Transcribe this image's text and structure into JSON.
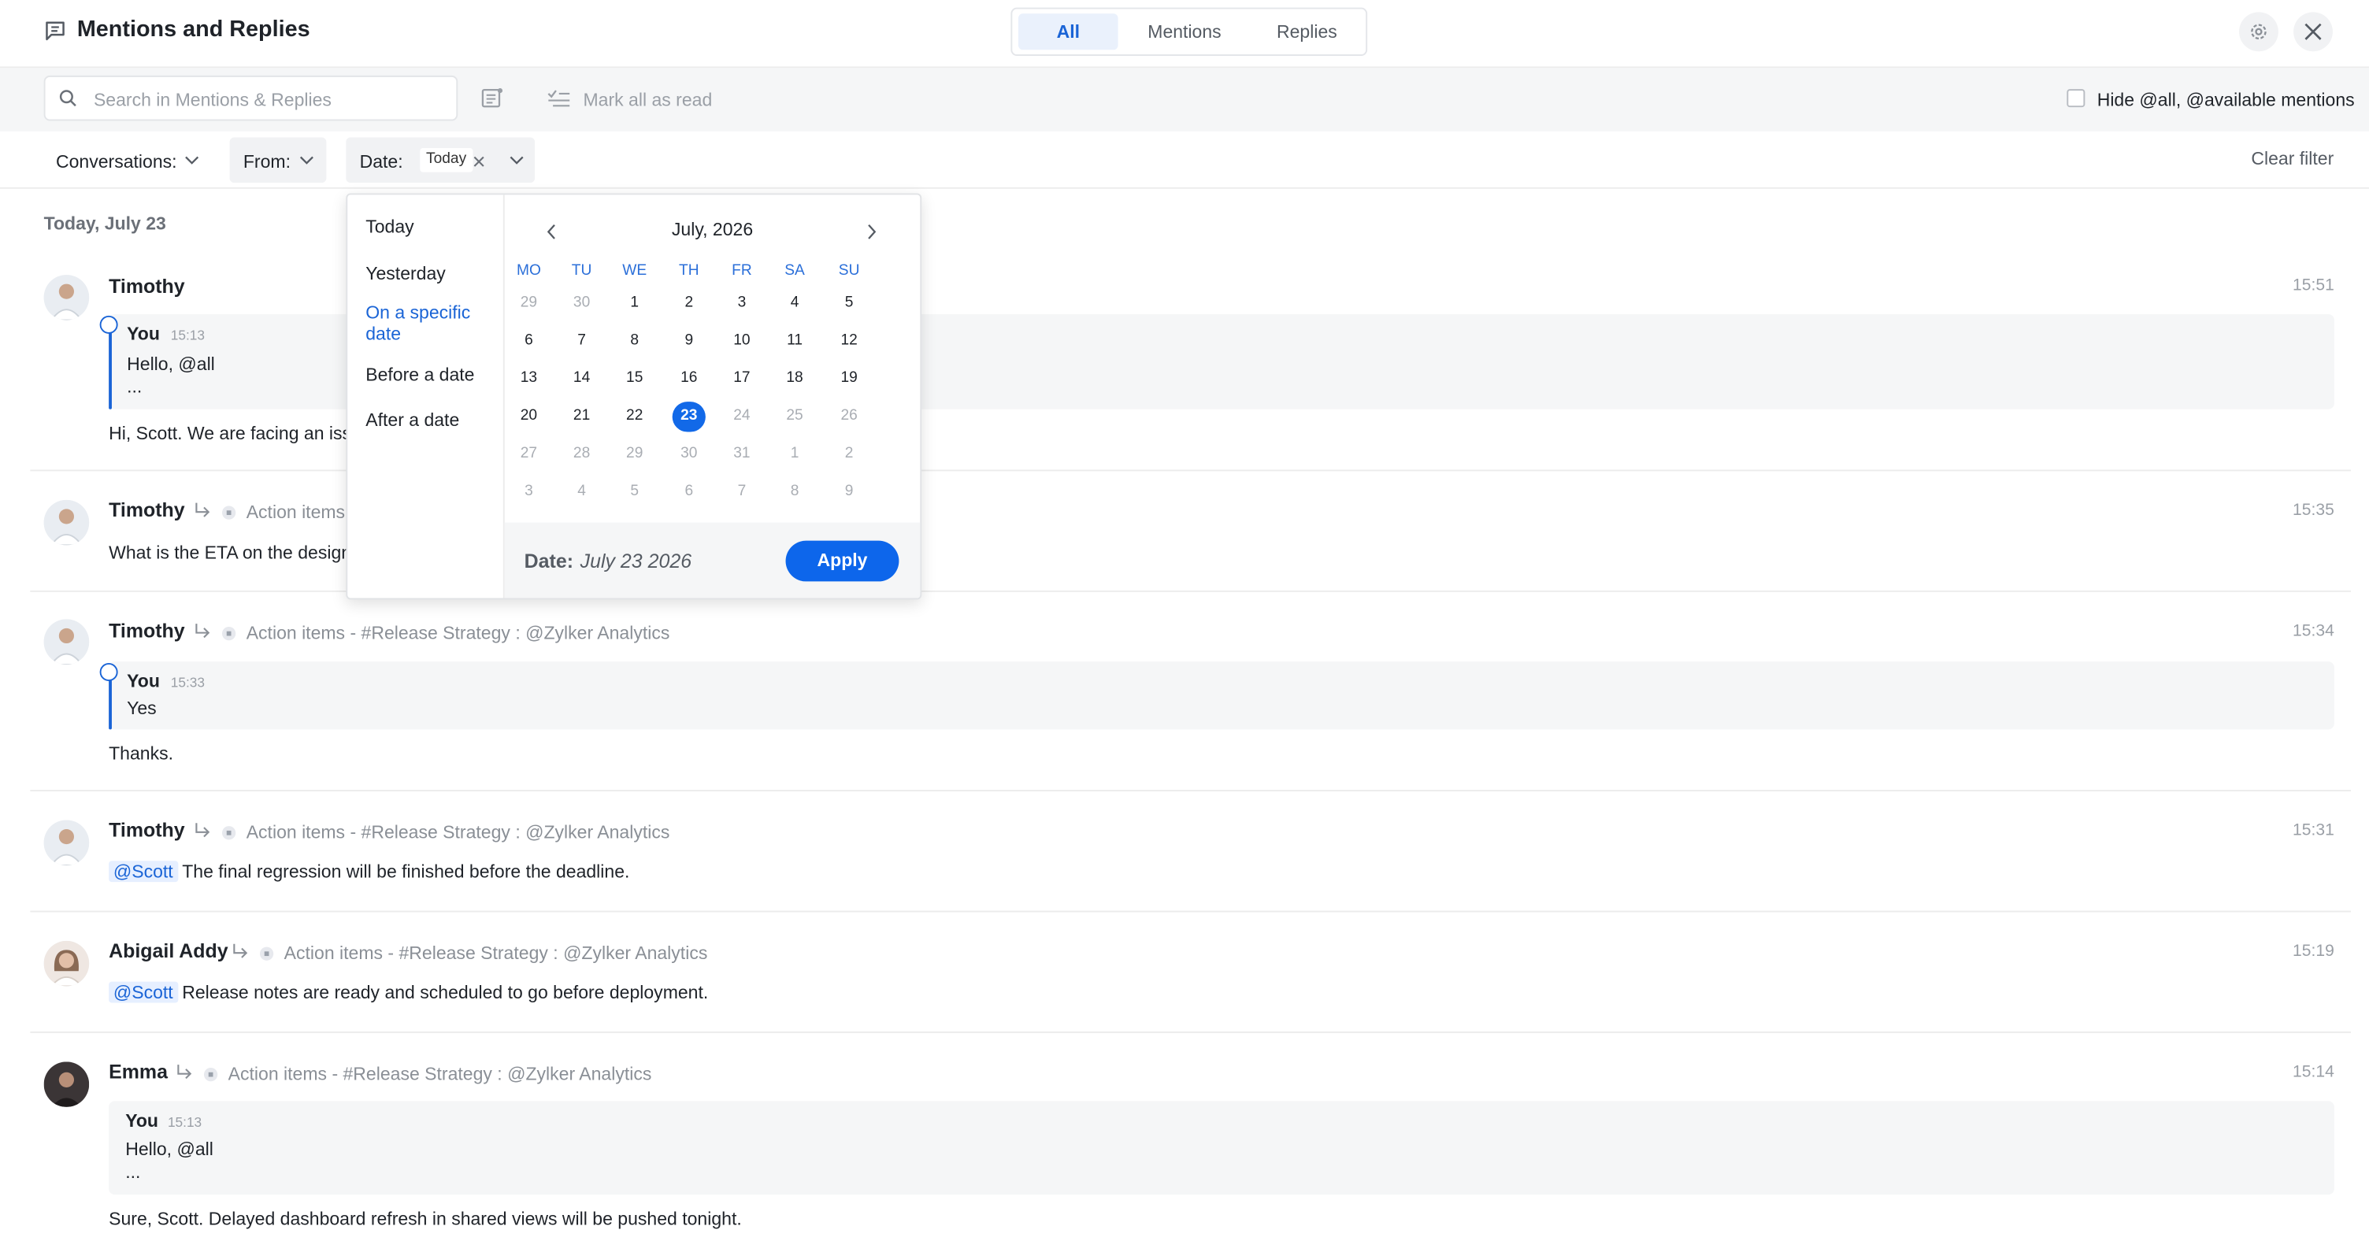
{
  "header": {
    "title": "Mentions and Replies",
    "tabs": [
      {
        "label": "All",
        "active": true
      },
      {
        "label": "Mentions",
        "active": false
      },
      {
        "label": "Replies",
        "active": false
      }
    ]
  },
  "toolbar": {
    "search_placeholder": "Search in Mentions & Replies",
    "mark_all_read": "Mark all as read",
    "hide_all_label": "Hide @all, @available mentions"
  },
  "filters": {
    "conversations": "Conversations:",
    "from": "From:",
    "date": "Date:",
    "date_chip": "Today",
    "clear": "Clear filter"
  },
  "date_heading": "Today, July 23",
  "messages": [
    {
      "name": "Timothy",
      "time": "15:51",
      "context": "",
      "quote": {
        "name": "You",
        "time": "15:13",
        "lines": [
          "Hello, @all",
          "..."
        ]
      },
      "mention": "",
      "text": "Hi, Scott. We are facing an issue"
    },
    {
      "name": "Timothy",
      "time": "15:35",
      "context": "Action items -",
      "mention": "",
      "text": "What is the ETA on the design?"
    },
    {
      "name": "Timothy",
      "time": "15:34",
      "context": "Action items - #Release Strategy : @Zylker Analytics",
      "quote": {
        "name": "You",
        "time": "15:33",
        "lines": [
          "Yes"
        ]
      },
      "mention": "",
      "text": "Thanks."
    },
    {
      "name": "Timothy",
      "time": "15:31",
      "context": "Action items - #Release Strategy : @Zylker Analytics",
      "mention": "@Scott",
      "text": "The final regression will be finished before the deadline."
    },
    {
      "name": "Abigail Addy",
      "time": "15:19",
      "context": "Action items - #Release Strategy : @Zylker Analytics",
      "mention": "@Scott",
      "text": "Release notes are ready and scheduled to go before deployment."
    },
    {
      "name": "Emma",
      "time": "15:14",
      "context": "Action items - #Release Strategy : @Zylker Analytics",
      "quote": {
        "name": "You",
        "time": "15:13",
        "lines": [
          "Hello, @all",
          "..."
        ]
      },
      "mention": "",
      "text": "Sure, Scott. Delayed dashboard refresh in shared views will be pushed tonight."
    }
  ],
  "date_popup": {
    "options": [
      {
        "label": "Today",
        "active": false
      },
      {
        "label": "Yesterday",
        "active": false
      },
      {
        "label": "On a specific date",
        "active": true
      },
      {
        "label": "Before a date",
        "active": false
      },
      {
        "label": "After a date",
        "active": false
      }
    ],
    "month_title": "July, 2026",
    "weekdays": [
      "MO",
      "TU",
      "WE",
      "TH",
      "FR",
      "SA",
      "SU"
    ],
    "weeks": [
      [
        {
          "d": "29",
          "m": true
        },
        {
          "d": "30",
          "m": true
        },
        {
          "d": "1"
        },
        {
          "d": "2"
        },
        {
          "d": "3"
        },
        {
          "d": "4"
        },
        {
          "d": "5"
        }
      ],
      [
        {
          "d": "6"
        },
        {
          "d": "7"
        },
        {
          "d": "8"
        },
        {
          "d": "9"
        },
        {
          "d": "10"
        },
        {
          "d": "11"
        },
        {
          "d": "12"
        }
      ],
      [
        {
          "d": "13"
        },
        {
          "d": "14"
        },
        {
          "d": "15"
        },
        {
          "d": "16"
        },
        {
          "d": "17"
        },
        {
          "d": "18"
        },
        {
          "d": "19"
        }
      ],
      [
        {
          "d": "20"
        },
        {
          "d": "21"
        },
        {
          "d": "22"
        },
        {
          "d": "23",
          "sel": true
        },
        {
          "d": "24",
          "m": true
        },
        {
          "d": "25",
          "m": true
        },
        {
          "d": "26",
          "m": true
        }
      ],
      [
        {
          "d": "27",
          "m": true
        },
        {
          "d": "28",
          "m": true
        },
        {
          "d": "29",
          "m": true
        },
        {
          "d": "30",
          "m": true
        },
        {
          "d": "31",
          "m": true
        },
        {
          "d": "1",
          "m": true
        },
        {
          "d": "2",
          "m": true
        }
      ],
      [
        {
          "d": "3",
          "m": true
        },
        {
          "d": "4",
          "m": true
        },
        {
          "d": "5",
          "m": true
        },
        {
          "d": "6",
          "m": true
        },
        {
          "d": "7",
          "m": true
        },
        {
          "d": "8",
          "m": true
        },
        {
          "d": "9",
          "m": true
        }
      ]
    ],
    "footer_label": "Date:",
    "footer_value": "July 23 2026",
    "apply": "Apply"
  },
  "colors": {
    "accent": "#0d66eb",
    "tab_active_bg": "#eaf1fc",
    "mention_bg": "#e6efff"
  }
}
